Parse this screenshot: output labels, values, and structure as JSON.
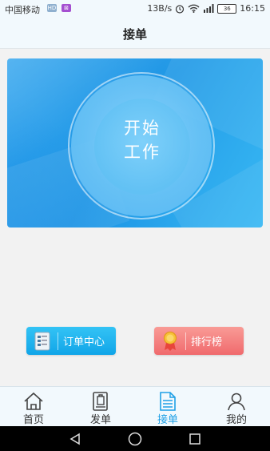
{
  "status_bar": {
    "carrier": "中国移动",
    "icon_a": "HD",
    "icon_b": "⊠",
    "speed": "13B/s",
    "signal": "2G",
    "battery": "36",
    "time": "16:15"
  },
  "header": {
    "title": "接单"
  },
  "banner": {
    "start_line1": "开始",
    "start_line2": "工作"
  },
  "actions": {
    "orders_label": "订单中心",
    "rank_label": "排行榜"
  },
  "nav": {
    "items": [
      {
        "label": "首页",
        "icon": "home-icon"
      },
      {
        "label": "发单",
        "icon": "publish-icon"
      },
      {
        "label": "接单",
        "icon": "receive-icon",
        "active": true
      },
      {
        "label": "我的",
        "icon": "profile-icon"
      }
    ],
    "active_color": "#1ea0e6"
  }
}
